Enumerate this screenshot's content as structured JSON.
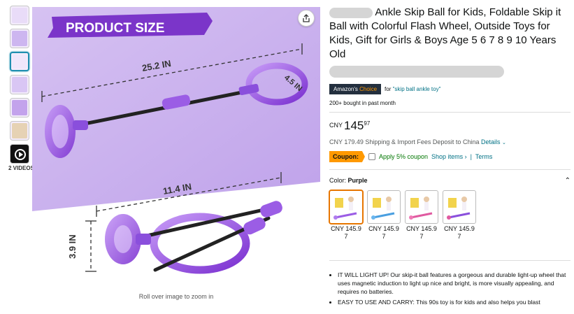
{
  "thumbnails": {
    "count": 7,
    "selected_index": 2,
    "video_label": "2 VIDEOS",
    "colors": [
      "#e9dcf8",
      "#cdb6f0",
      "#efe7fb",
      "#d9c6f4",
      "#c3a3ec",
      "#e6d2b4"
    ]
  },
  "main_image": {
    "banner": "PRODUCT SIZE",
    "dimension_length": "25.2 IN",
    "dimension_ring": "4.5 IN",
    "dimension_folded_length": "11.4 IN",
    "dimension_folded_height": "3.9 IN",
    "zoom_hint": "Roll over image to zoom in",
    "share_icon": "share-icon"
  },
  "product": {
    "title": "Ankle Skip Ball for Kids, Foldable Skip it Ball with Colorful Flash Wheel, Outside Toys for Kids, Gift for Girls & Boys Age 5 6 7 8 9 10 Years Old",
    "choice_badge_prefix": "Amazon's",
    "choice_badge_suffix": "Choice",
    "choice_for": "for",
    "choice_keyword": "\"skip ball ankle toy\"",
    "bought": "200+ bought in past month",
    "price_currency": "CNY",
    "price_whole": "145",
    "price_fraction": "97",
    "shipping_text": "CNY 179.49 Shipping & Import Fees Deposit to China",
    "shipping_details": "Details",
    "coupon_label": "Coupon:",
    "coupon_apply": "Apply 5% coupon",
    "coupon_shop": "Shop items ›",
    "coupon_sep": "|",
    "coupon_terms": "Terms",
    "color_label": "Color:",
    "color_value": "Purple",
    "swatches": [
      {
        "price": "CNY 145.97",
        "selected": true
      },
      {
        "price": "CNY 145.97",
        "selected": false
      },
      {
        "price": "CNY 145.97",
        "selected": false
      },
      {
        "price": "CNY 145.97",
        "selected": false
      }
    ],
    "bullets": [
      "IT WILL LIGHT UP! Our skip-it ball features a gorgeous and durable light-up wheel that uses magnetic induction to light up nice and bright, is more visually appealing, and requires no batteries.",
      "EASY TO USE AND CARRY: This 90s toy is for kids and also helps you blast"
    ]
  },
  "colors": {
    "accent_purple": "#9b5de5",
    "link": "#007185",
    "coupon_orange": "#ff9900",
    "choice_navy": "#232f3e"
  }
}
